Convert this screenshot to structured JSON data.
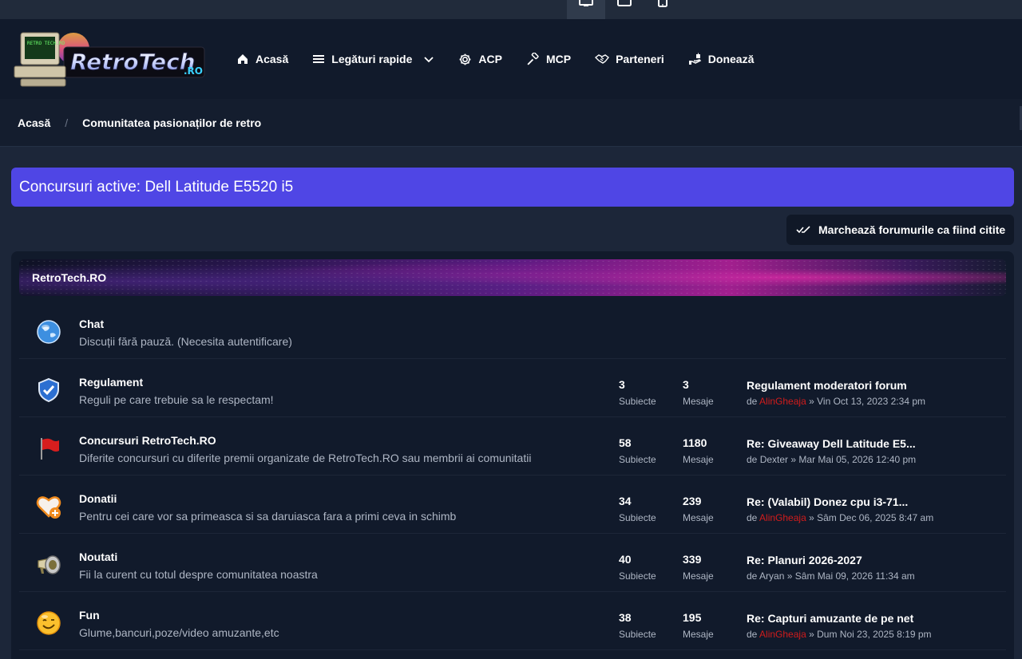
{
  "colors": {
    "accent": "#4f46e5",
    "header_bg": "#111a2b",
    "page_bg": "#1c2639",
    "admin_user": "#d11c1c"
  },
  "device_switcher": [
    {
      "icon": "desktop-icon"
    },
    {
      "icon": "tablet-icon"
    },
    {
      "icon": "mobile-icon"
    }
  ],
  "logo": {
    "text": "RetroTech",
    "suffix": ".RO",
    "screen_text": "RETRO TECH.RO"
  },
  "nav": [
    {
      "label": "Acasă",
      "icon": "home-icon"
    },
    {
      "label": "Legături rapide",
      "icon": "menu-icon"
    },
    {
      "label": "ACP",
      "icon": "gear-icon"
    },
    {
      "label": "MCP",
      "icon": "gavel-icon"
    },
    {
      "label": "Parteneri",
      "icon": "handshake-icon"
    },
    {
      "label": "Donează",
      "icon": "donate-icon"
    }
  ],
  "breadcrumb": {
    "home": "Acasă",
    "current": "Comunitatea pasionaților de retro",
    "separator": "/"
  },
  "announcement": "Concursuri active: Dell Latitude E5520 i5",
  "mark_read": "Marchează forumurile ca fiind citite",
  "category": {
    "title": "RetroTech.RO"
  },
  "labels": {
    "topics": "Subiecte",
    "posts": "Mesaje",
    "by": "de",
    "sep": "»"
  },
  "forums": [
    {
      "name": "Chat",
      "desc": "Discuții fără pauză. (Necesita autentificare)",
      "icon": "globe-icon"
    },
    {
      "name": "Regulament",
      "desc": "Reguli pe care trebuie sa le respectam!",
      "icon": "shield-check-icon",
      "topics": "3",
      "posts": "3",
      "last_title": "Regulament moderatori forum",
      "last_user": "AlinGheaja",
      "last_user_admin": true,
      "last_date": "Vin Oct 13, 2023 2:34 pm"
    },
    {
      "name": "Concursuri RetroTech.RO",
      "desc": "Diferite concursuri cu diferite premii organizate de RetroTech.RO sau membrii ai comunitatii",
      "icon": "flag-icon",
      "topics": "58",
      "posts": "1180",
      "last_title": "Re: Giveaway Dell Latitude E5...",
      "last_user": "Dexter",
      "last_user_admin": false,
      "last_date": "Mar Mai 05, 2026 12:40 pm"
    },
    {
      "name": "Donatii",
      "desc": "Pentru cei care vor sa primeasca si sa daruiasca fara a primi ceva in schimb",
      "icon": "heart-plus-icon",
      "topics": "34",
      "posts": "239",
      "last_title": "Re: (Valabil) Donez cpu i3-71...",
      "last_user": "AlinGheaja",
      "last_user_admin": true,
      "last_date": "Sâm Dec 06, 2025 8:47 am"
    },
    {
      "name": "Noutati",
      "desc": "Fii la curent cu totul despre comunitatea noastra",
      "icon": "megaphone-icon",
      "topics": "40",
      "posts": "339",
      "last_title": "Re: Planuri 2026-2027",
      "last_user": "Aryan",
      "last_user_admin": false,
      "last_date": "Sâm Mai 09, 2026 11:34 am"
    },
    {
      "name": "Fun",
      "desc": "Glume,bancuri,poze/video amuzante,etc",
      "icon": "smiley-icon",
      "topics": "38",
      "posts": "195",
      "last_title": "Re: Capturi amuzante de pe net",
      "last_user": "AlinGheaja",
      "last_user_admin": true,
      "last_date": "Dum Noi 23, 2025 8:19 pm"
    }
  ]
}
